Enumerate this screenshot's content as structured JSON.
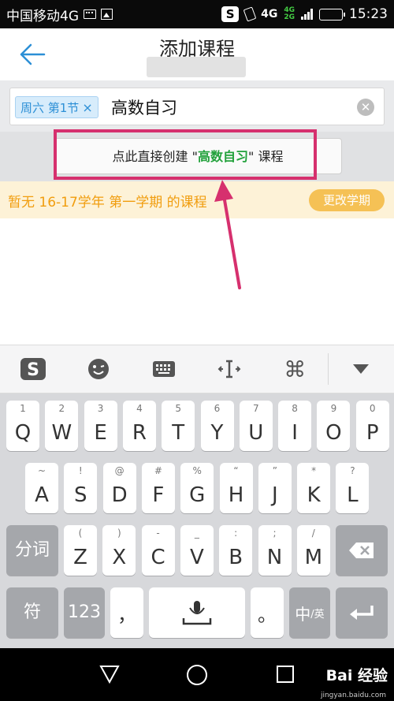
{
  "status_bar": {
    "carrier": "中国移动4G",
    "network": "4G",
    "network_small_top": "4G",
    "network_small_bottom": "2G",
    "time": "15:23"
  },
  "header": {
    "title": "添加课程",
    "back_icon": "arrow-left-icon",
    "accent_color": "#2c8fd6"
  },
  "search": {
    "chip_label": "周六 第1节",
    "chip_close": "×",
    "query": "高数自习",
    "clear_icon": "clear-circle-icon"
  },
  "suggestion": {
    "prefix": "点此直接创建 \"",
    "highlight": "高数自习",
    "suffix": "\" 课程",
    "highlight_color": "#22a13b"
  },
  "annotation": {
    "box_color": "#d6306e"
  },
  "term_notice": {
    "text": "暂无 16-17学年 第一学期 的课程",
    "button": "更改学期"
  },
  "keyboard_toolbar": {
    "icons": [
      "sogou-s-icon",
      "emoji-icon",
      "keyboard-icon",
      "cursor-icon",
      "command-icon",
      "collapse-icon"
    ]
  },
  "keyboard": {
    "row1": [
      {
        "sub": "1",
        "main": "Q"
      },
      {
        "sub": "2",
        "main": "W"
      },
      {
        "sub": "3",
        "main": "E"
      },
      {
        "sub": "4",
        "main": "R"
      },
      {
        "sub": "5",
        "main": "T"
      },
      {
        "sub": "6",
        "main": "Y"
      },
      {
        "sub": "7",
        "main": "U"
      },
      {
        "sub": "8",
        "main": "I"
      },
      {
        "sub": "9",
        "main": "O"
      },
      {
        "sub": "0",
        "main": "P"
      }
    ],
    "row2": [
      {
        "sub": "~",
        "main": "A"
      },
      {
        "sub": "!",
        "main": "S"
      },
      {
        "sub": "@",
        "main": "D"
      },
      {
        "sub": "#",
        "main": "F"
      },
      {
        "sub": "%",
        "main": "G"
      },
      {
        "sub": "“",
        "main": "H"
      },
      {
        "sub": "”",
        "main": "J"
      },
      {
        "sub": "*",
        "main": "K"
      },
      {
        "sub": "?",
        "main": "L"
      }
    ],
    "row3_left": "分词",
    "row3": [
      {
        "sub": "(",
        "main": "Z"
      },
      {
        "sub": ")",
        "main": "X"
      },
      {
        "sub": "-",
        "main": "C"
      },
      {
        "sub": "_",
        "main": "V"
      },
      {
        "sub": ":",
        "main": "B"
      },
      {
        "sub": ";",
        "main": "N"
      },
      {
        "sub": "/",
        "main": "M"
      }
    ],
    "row3_right_icon": "backspace-icon",
    "row4": {
      "symbols": "符",
      "numbers": "123",
      "comma": "，",
      "space_icon": "microphone-icon",
      "period": "。",
      "lang_main": "中",
      "lang_sub": "/英",
      "enter_icon": "enter-icon"
    }
  },
  "nav_bar": {
    "back_icon": "triangle-back-icon",
    "home_icon": "circle-home-icon",
    "recent_icon": "square-recent-icon",
    "watermark": "Bai 经验",
    "watermark_url": "jingyan.baidu.com"
  }
}
